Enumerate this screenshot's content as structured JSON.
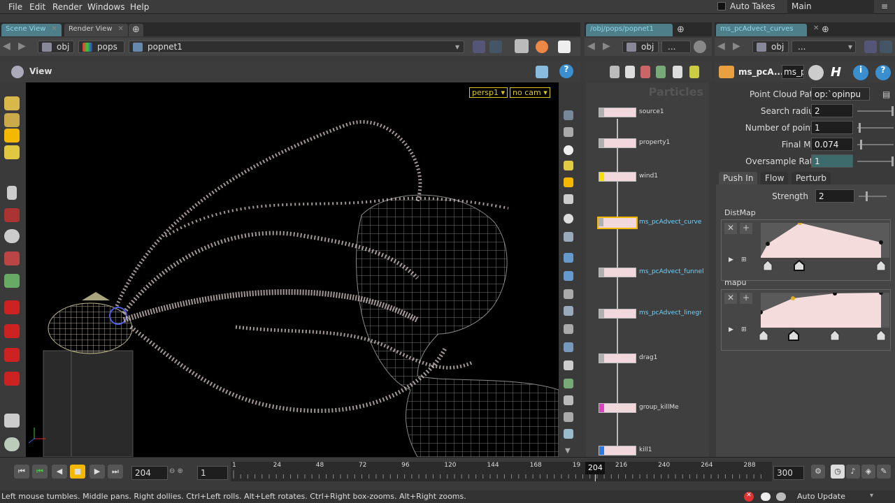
{
  "menu": {
    "items": [
      "File",
      "Edit",
      "Render",
      "Windows",
      "Help"
    ]
  },
  "header": {
    "auto_takes": "Auto Takes",
    "take": "Main"
  },
  "scene": {
    "tabs": [
      "Scene View",
      "Render View"
    ],
    "breadcrumbs": [
      "obj",
      "pops",
      "popnet1"
    ],
    "view_label": "View",
    "persp": "persp1 ▾",
    "cam": "no cam ▾"
  },
  "network": {
    "tab": "/obj/pops/popnet1",
    "breadcrumbs": [
      "obj",
      "..."
    ],
    "context_label": "Particles",
    "nodes": [
      {
        "label": "source1",
        "flag": "#b0b0b0",
        "selected": false,
        "highlight": false
      },
      {
        "label": "property1",
        "flag": "#b0b0b0",
        "selected": false,
        "highlight": false
      },
      {
        "label": "wind1",
        "flag": "#f5e000",
        "selected": false,
        "highlight": false
      },
      {
        "label": "ms_pcAdvect_curve",
        "flag": "#b0b0b0",
        "selected": true,
        "highlight": true
      },
      {
        "label": "ms_pcAdvect_funnel",
        "flag": "#b0b0b0",
        "selected": false,
        "highlight": true
      },
      {
        "label": "ms_pcAdvect_linegr",
        "flag": "#b0b0b0",
        "selected": false,
        "highlight": true
      },
      {
        "label": "drag1",
        "flag": "#b0b0b0",
        "selected": false,
        "highlight": false
      },
      {
        "label": "group_killMe",
        "flag": "#e040c0",
        "selected": false,
        "highlight": false
      },
      {
        "label": "kill1",
        "flag": "#2a7ae0",
        "selected": false,
        "highlight": false
      }
    ]
  },
  "params_pane": {
    "tab": "ms_pcAdvect_curves",
    "breadcrumbs": [
      "obj",
      "..."
    ],
    "node_name": "ms_pcA...",
    "node_field": "ms_p",
    "rows": [
      {
        "label": "Point Cloud Path",
        "value": "op:`opinpu"
      },
      {
        "label": "Search radius",
        "value": "2"
      },
      {
        "label": "Number of points",
        "value": "1"
      },
      {
        "label": "Final Mix",
        "value": "0.074"
      },
      {
        "label": "Oversample Rate",
        "value": "1"
      }
    ],
    "tabs": [
      "Push In",
      "Flow",
      "Perturb"
    ],
    "strength_label": "Strength",
    "strength_value": "2",
    "ramps": [
      {
        "label": "DistMap"
      },
      {
        "label": "mapu"
      }
    ]
  },
  "timeline": {
    "current_frame": "204",
    "step": "1",
    "ticks": [
      "1",
      "24",
      "48",
      "72",
      "96",
      "120",
      "144",
      "168",
      "19",
      "216",
      "240",
      "264",
      "288"
    ],
    "playhead": "204",
    "end_frame": "300"
  },
  "status": {
    "hint": "Left mouse tumbles. Middle pans. Right dollies. Ctrl+Left rolls. Alt+Left rotates. Ctrl+Right box-zooms. Alt+Right zooms.",
    "auto_update": "Auto Update"
  },
  "colors": {
    "accent": "#4d7e8a",
    "selection": "#f5b800",
    "node_highlight": "#6cd3ff"
  }
}
